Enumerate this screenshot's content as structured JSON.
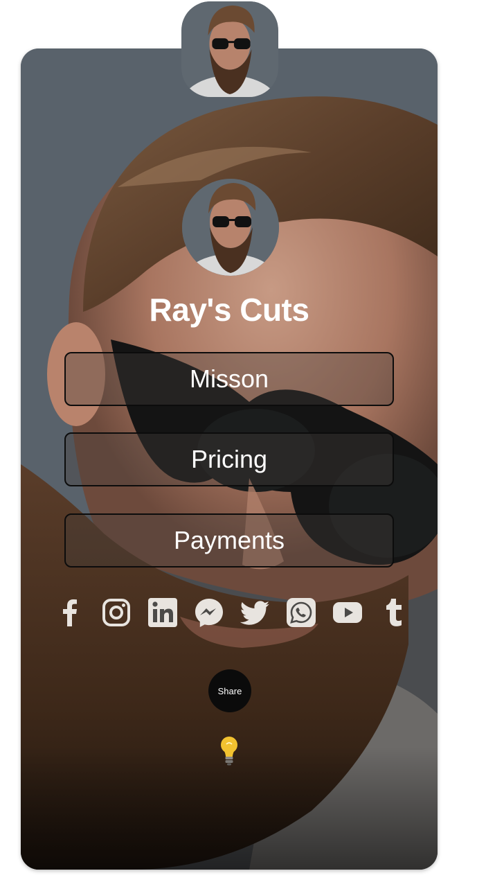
{
  "profile": {
    "title": "Ray's Cuts"
  },
  "links": [
    {
      "label": "Misson"
    },
    {
      "label": "Pricing"
    },
    {
      "label": "Payments"
    }
  ],
  "socials": [
    {
      "icon": "facebook-icon"
    },
    {
      "icon": "instagram-icon"
    },
    {
      "icon": "linkedin-icon"
    },
    {
      "icon": "messenger-icon"
    },
    {
      "icon": "twitter-icon"
    },
    {
      "icon": "whatsapp-icon"
    },
    {
      "icon": "youtube-icon"
    },
    {
      "icon": "tumblr-icon"
    }
  ],
  "share": {
    "label": "Share"
  },
  "theme": {
    "icon_color": "#e8e4df",
    "button_border": "#0c0c0c",
    "text_color": "#ffffff",
    "bulb_color": "#f2c230"
  }
}
